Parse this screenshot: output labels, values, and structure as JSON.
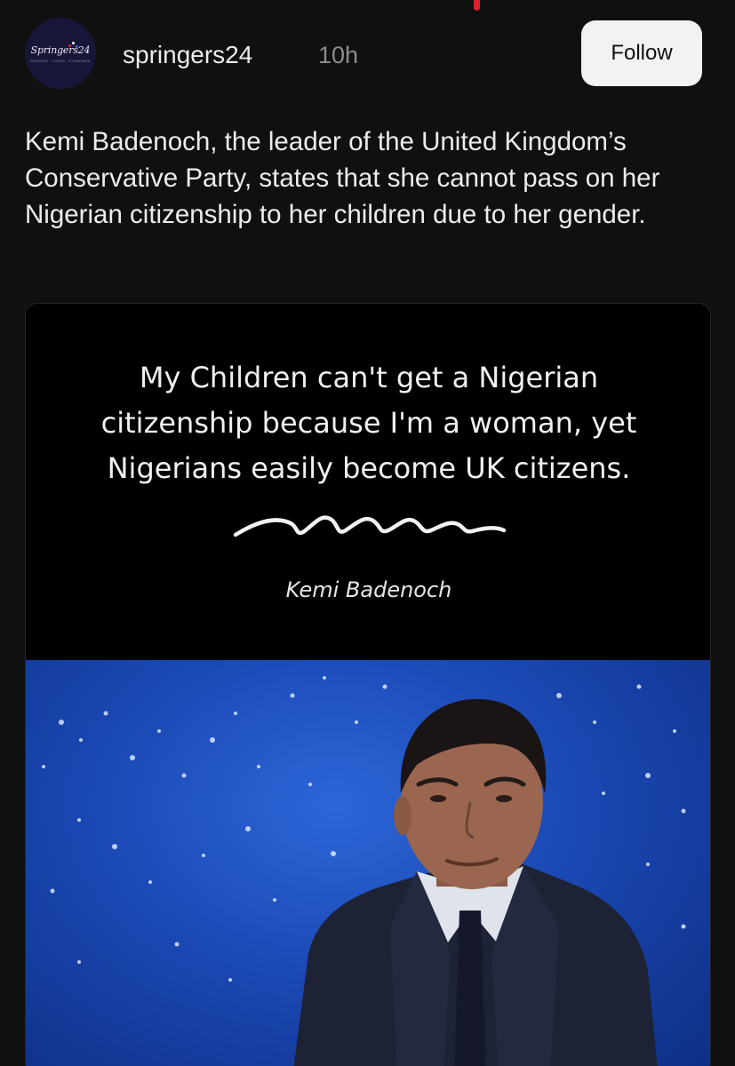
{
  "post": {
    "author": {
      "username": "springers24",
      "avatar_label": "Springers24",
      "avatar_tagline": "FASHION · LIVING · STANDARD",
      "avatar_dot_colors": [
        "#e0203a",
        "#f4f4f4",
        "#3b6df0"
      ]
    },
    "time_ago": "10h",
    "follow_label": "Follow",
    "caption": "Kemi Badenoch, the leader of the United Kingdom’s Conservative Party, states that she cannot pass on her Nigerian citizenship to her children due to her gender."
  },
  "media": {
    "quote_lines": [
      "My Children can't get a Nigerian",
      "citizenship because I'm a woman, yet",
      "Nigerians easily become UK citizens."
    ],
    "quote_author": "Kemi Badenoch",
    "photo_subject": "man in dark suit in front of a blue world map backdrop"
  },
  "colors": {
    "background": "#101010",
    "text_primary": "#ececec",
    "text_secondary": "#8c8c8c",
    "button_bg": "#f2f2f2",
    "accent_top": "#e0202a",
    "photo_blue": "#1a48b4"
  }
}
